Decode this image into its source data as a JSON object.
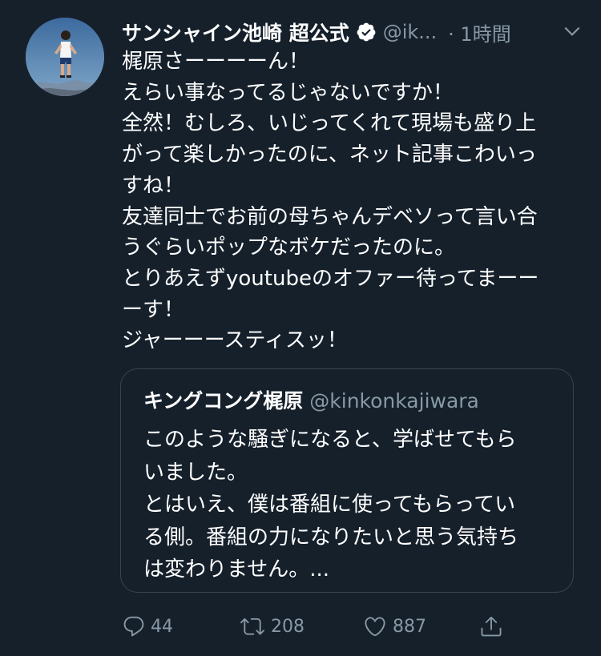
{
  "author": {
    "display_name": "サンシャイン池崎 超公式",
    "handle": "@ik...",
    "time": "· 1時間"
  },
  "tweet": {
    "lines": [
      "梶原さーーーーん！",
      "えらい事なってるじゃないですか！",
      "全然！むしろ、いじってくれて現場も盛り上",
      "がって楽しかったのに、ネット記事こわいっ",
      "すね！",
      "友達同士でお前の母ちゃんデベソって言い合",
      "うぐらいポップなボケだったのに。",
      "とりあえずyoutubeのオファー待ってまーー",
      "ーす！",
      "ジャーーースティスッ！"
    ]
  },
  "quoted": {
    "display_name": "キングコング梶原",
    "handle": "@kinkonkajiwara",
    "lines": [
      "このような騒ぎになると、学ばせてもら",
      "いました。",
      "とはいえ、僕は番組に使ってもらってい",
      "る側。番組の力になりたいと思う気持ち",
      "は変わりません。..."
    ]
  },
  "actions": {
    "reply_count": "44",
    "retweet_count": "208",
    "like_count": "887"
  },
  "icons": {
    "verified": "verified-badge-icon",
    "caret": "chevron-down-icon",
    "reply": "reply-icon",
    "retweet": "retweet-icon",
    "like": "heart-icon",
    "share": "share-icon"
  },
  "colors": {
    "background": "#15202b",
    "text": "#ffffff",
    "secondary": "#8899a6",
    "border": "#38444d"
  }
}
